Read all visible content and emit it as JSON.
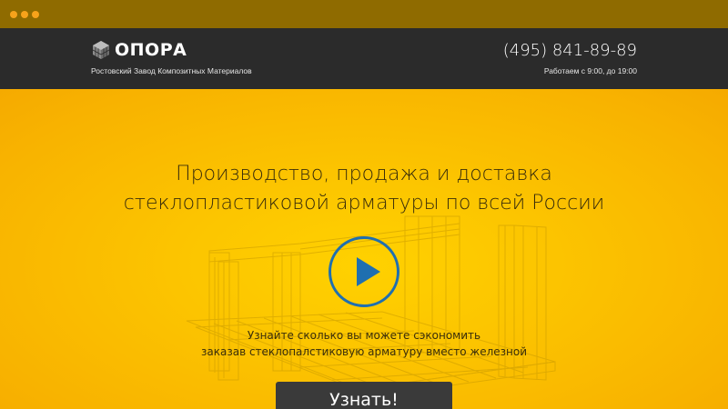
{
  "header": {
    "logo_text": "ОПОРА",
    "tagline": "Ростовский Завод Композитных Материалов",
    "phone": "(495) 841-89-89",
    "hours": "Работаем с 9:00, до 19:00"
  },
  "hero": {
    "title_line1": "Производство, продажа и доставка",
    "title_line2": "стеклопластиковой арматуры по всей России",
    "subtext_line1": "Узнайте сколько вы можете сэкономить",
    "subtext_line2": "заказав стеклопалстиковую арматуру вместо железной",
    "cta_label": "Узнать!"
  },
  "colors": {
    "chrome": "#8f6b00",
    "header_bg": "#2b2b2b",
    "hero_yellow": "#fbba00",
    "play_blue": "#1f6fb0",
    "cta_bg": "#3a3a3a"
  },
  "icons": {
    "logo": "logo-cube-icon",
    "play": "play-icon",
    "window_controls": "window-dot-icon"
  }
}
